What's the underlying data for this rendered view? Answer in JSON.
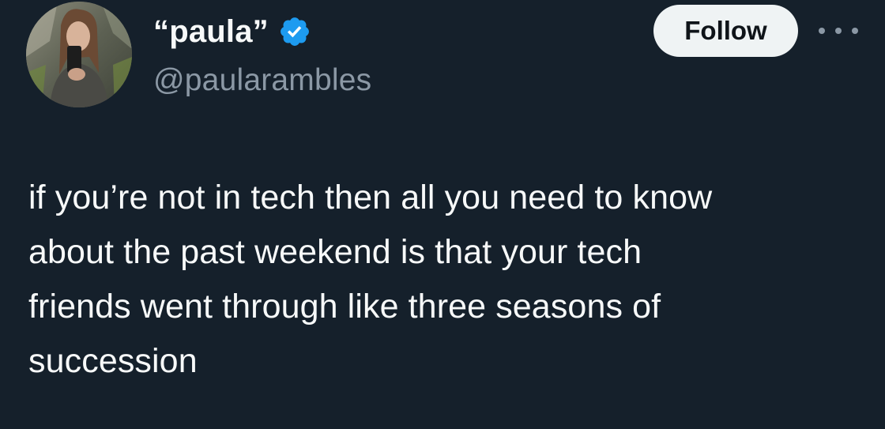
{
  "author": {
    "display_name": "“paula”",
    "handle": "@paularambles",
    "verified": true,
    "verified_badge_color": "#1d9bf0"
  },
  "actions": {
    "follow_label": "Follow",
    "more_icon": "more-horizontal-icon"
  },
  "tweet": {
    "lines": [
      "if you’re not in tech then all you need to know",
      "about the past weekend is that your tech",
      "friends went through like three seasons of",
      "succession"
    ]
  },
  "colors": {
    "background": "#15202b",
    "primary_text": "#f7f9f9",
    "secondary_text": "#8b98a5",
    "follow_button_bg": "#eff3f4"
  }
}
